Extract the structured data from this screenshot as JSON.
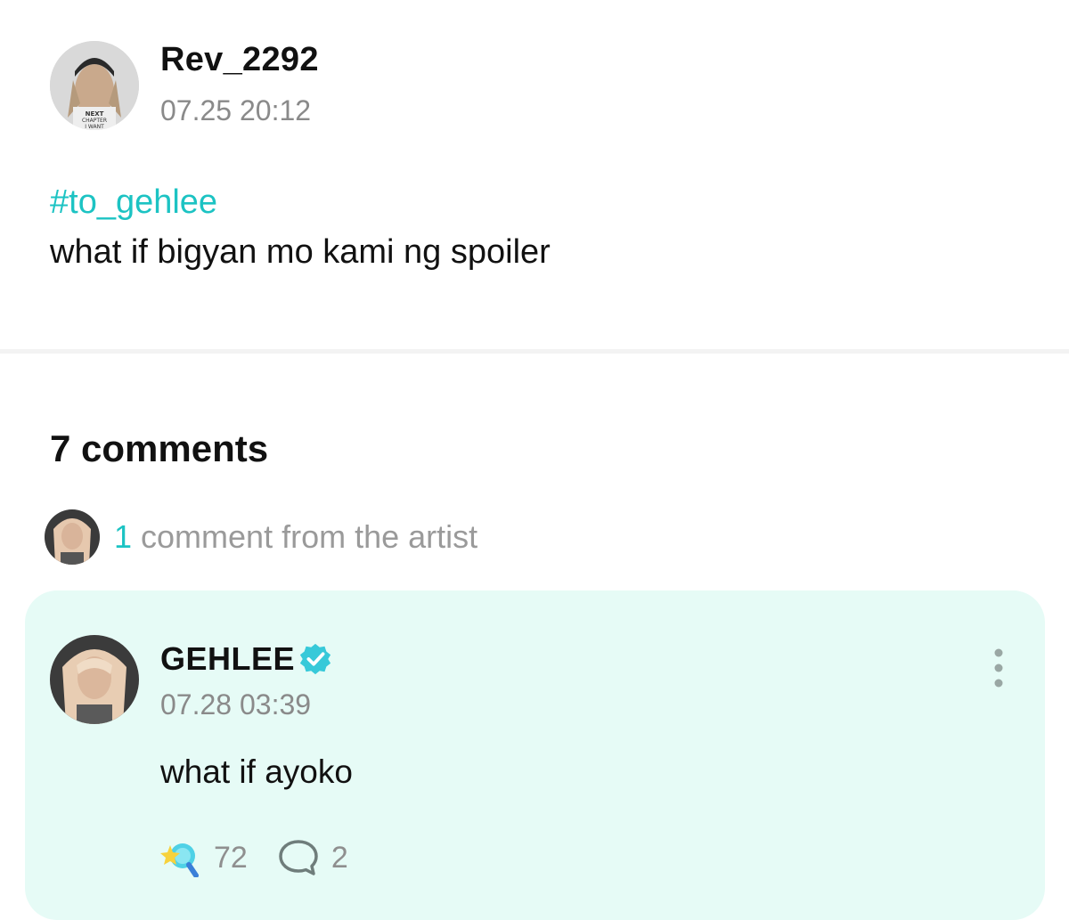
{
  "post": {
    "author": "Rev_2292",
    "timestamp": "07.25 20:12",
    "hashtag": "#to_gehlee",
    "body": "what if bigyan mo kami ng spoiler",
    "avatar_shirt_text": "NEXT CHAPTER I WANT"
  },
  "comments_section": {
    "heading": "7 comments",
    "artist_summary": {
      "count": "1",
      "text": " comment from the artist"
    }
  },
  "artist_comment": {
    "author": "GEHLEE",
    "verified_icon": "verified-check-icon",
    "timestamp": "07.28 03:39",
    "body": "what if ayoko",
    "like_icon": "star-lightbulb-icon",
    "like_count": "72",
    "reply_icon": "chat-bubble-icon",
    "reply_count": "2",
    "more_icon": "more-vertical-icon"
  },
  "colors": {
    "accent": "#1cc3c3",
    "card_background": "#e6fbf6",
    "muted_text": "#8a8a8a",
    "primary_text": "#111111"
  }
}
